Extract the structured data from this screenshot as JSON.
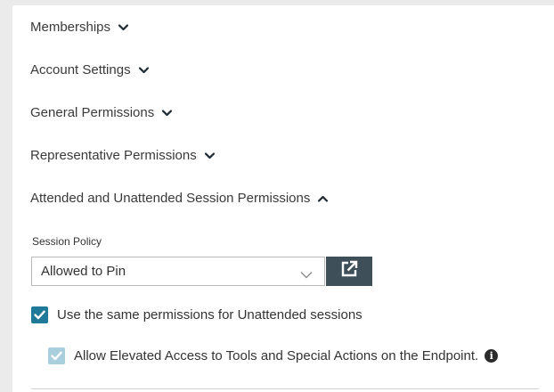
{
  "sections": [
    {
      "label": "Memberships",
      "expanded": false
    },
    {
      "label": "Account Settings",
      "expanded": false
    },
    {
      "label": "General Permissions",
      "expanded": false
    },
    {
      "label": "Representative Permissions",
      "expanded": false
    },
    {
      "label": "Attended and Unattended Session Permissions",
      "expanded": true
    }
  ],
  "session_policy": {
    "label": "Session Policy",
    "value": "Allowed to Pin",
    "open_button_icon": "external-link-icon"
  },
  "checkboxes": {
    "same_permissions": {
      "label": "Use the same permissions for Unattended sessions",
      "checked": true,
      "disabled": false
    },
    "elevated_access": {
      "label": "Allow Elevated Access to Tools and Special Actions on the Endpoint.",
      "checked": true,
      "disabled": true
    }
  },
  "info_icon": "info-icon",
  "colors": {
    "checkbox_checked": "#1f7a9a",
    "checkbox_disabled": "#a9cfdc",
    "button_dark": "#3e4f5a"
  }
}
